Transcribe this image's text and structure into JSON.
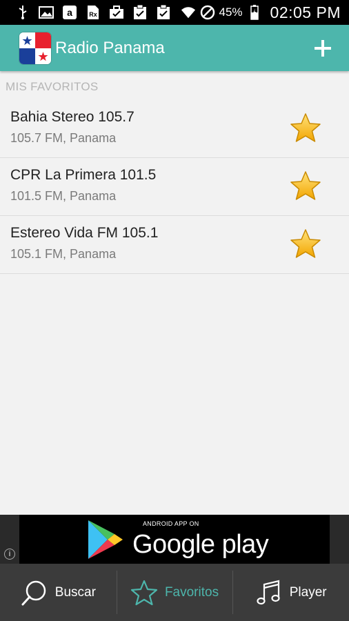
{
  "status_bar": {
    "battery_percent": "45%",
    "time": "02:05 PM",
    "left_icons": [
      "usb-icon",
      "image-icon",
      "amazon-icon",
      "rx-icon",
      "briefcase-check-icon",
      "clipboard-check-icon",
      "clipboard-check-icon"
    ],
    "right_icons": [
      "wifi-icon",
      "do-not-disturb-icon",
      "battery-icon"
    ]
  },
  "app_bar": {
    "title": "Radio Panama",
    "logo": "panama-flag-icon",
    "action": "plus-icon",
    "color": "#4db6ac"
  },
  "section": {
    "header": "MIS FAVORITOS"
  },
  "favorites": [
    {
      "title": "Bahia Stereo 105.7",
      "subtitle": "105.7 FM, Panama",
      "icon": "star-icon"
    },
    {
      "title": "CPR La Primera 101.5",
      "subtitle": "101.5 FM, Panama",
      "icon": "star-icon"
    },
    {
      "title": "Estereo Vida FM 105.1",
      "subtitle": "105.1 FM, Panama",
      "icon": "star-icon"
    }
  ],
  "ad": {
    "small_text": "ANDROID APP ON",
    "brand": "Google play",
    "info_icon": "info-icon"
  },
  "bottom_nav": {
    "tabs": [
      {
        "label": "Buscar",
        "icon": "search-icon",
        "active": false
      },
      {
        "label": "Favoritos",
        "icon": "star-outline-icon",
        "active": true
      },
      {
        "label": "Player",
        "icon": "music-note-icon",
        "active": false
      }
    ],
    "active_color": "#4db6ac"
  }
}
